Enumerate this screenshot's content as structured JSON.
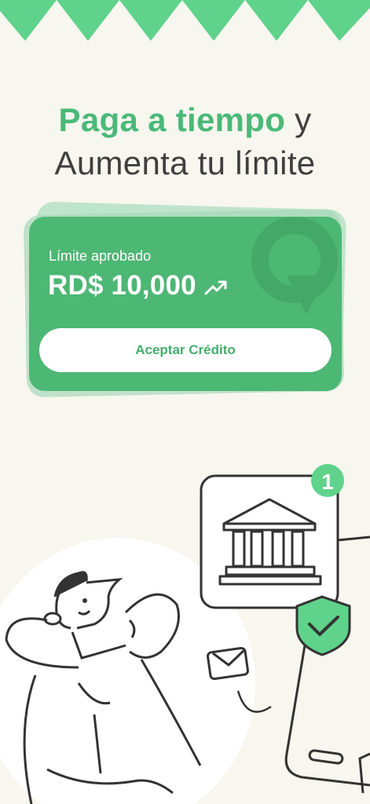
{
  "colors": {
    "background": "#f7f6ef",
    "brand_green": "#4ab978",
    "card_green": "#4db774",
    "text_dark": "#3f3f3f",
    "button_bg": "#ffffff",
    "button_text": "#43ad6c"
  },
  "headline": {
    "part1_highlight": "Paga a tiempo",
    "part1_rest": " y",
    "line2": "Aumenta tu límite"
  },
  "card": {
    "label": "Límite aprobado",
    "amount": "RD$ 10,000",
    "trend_icon": "trending-up-icon",
    "button_label": "Aceptar Crédito"
  },
  "illustration": {
    "step_badge": "1",
    "icons": [
      "bank-icon",
      "shield-check-icon",
      "envelope-icon",
      "phone-icon"
    ]
  }
}
